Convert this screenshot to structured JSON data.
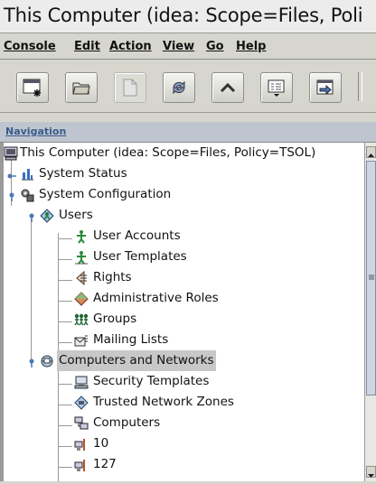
{
  "window": {
    "title": "This Computer (idea: Scope=Files, Poli"
  },
  "menubar": [
    "Console",
    "Edit",
    "Action",
    "View",
    "Go",
    "Help"
  ],
  "toolbar": [
    "open-console-icon",
    "folder-icon",
    "document-icon",
    "refresh-icon",
    "up-arrow-icon",
    "view-options-icon",
    "import-export-icon"
  ],
  "navigation": {
    "header": "Navigation",
    "tree": [
      {
        "label": "This Computer (idea: Scope=Files, Policy=TSOL)",
        "icon": "computer-icon"
      },
      {
        "label": "System Status",
        "icon": "status-chart-icon"
      },
      {
        "label": "System Configuration",
        "icon": "config-icon"
      },
      {
        "label": "Users",
        "icon": "users-icon"
      },
      {
        "label": "User Accounts",
        "icon": "user-account-icon"
      },
      {
        "label": "User Templates",
        "icon": "user-template-icon"
      },
      {
        "label": "Rights",
        "icon": "rights-icon"
      },
      {
        "label": "Administrative Roles",
        "icon": "role-icon"
      },
      {
        "label": "Groups",
        "icon": "groups-icon"
      },
      {
        "label": "Mailing Lists",
        "icon": "mailing-list-icon"
      },
      {
        "label": "Computers and Networks",
        "icon": "network-icon"
      },
      {
        "label": "Security Templates",
        "icon": "security-template-icon"
      },
      {
        "label": "Trusted Network Zones",
        "icon": "network-zone-icon"
      },
      {
        "label": "Computers",
        "icon": "computers-icon"
      },
      {
        "label": "10",
        "icon": "computer-subnet-icon"
      },
      {
        "label": "127",
        "icon": "computer-subnet-icon"
      }
    ]
  }
}
